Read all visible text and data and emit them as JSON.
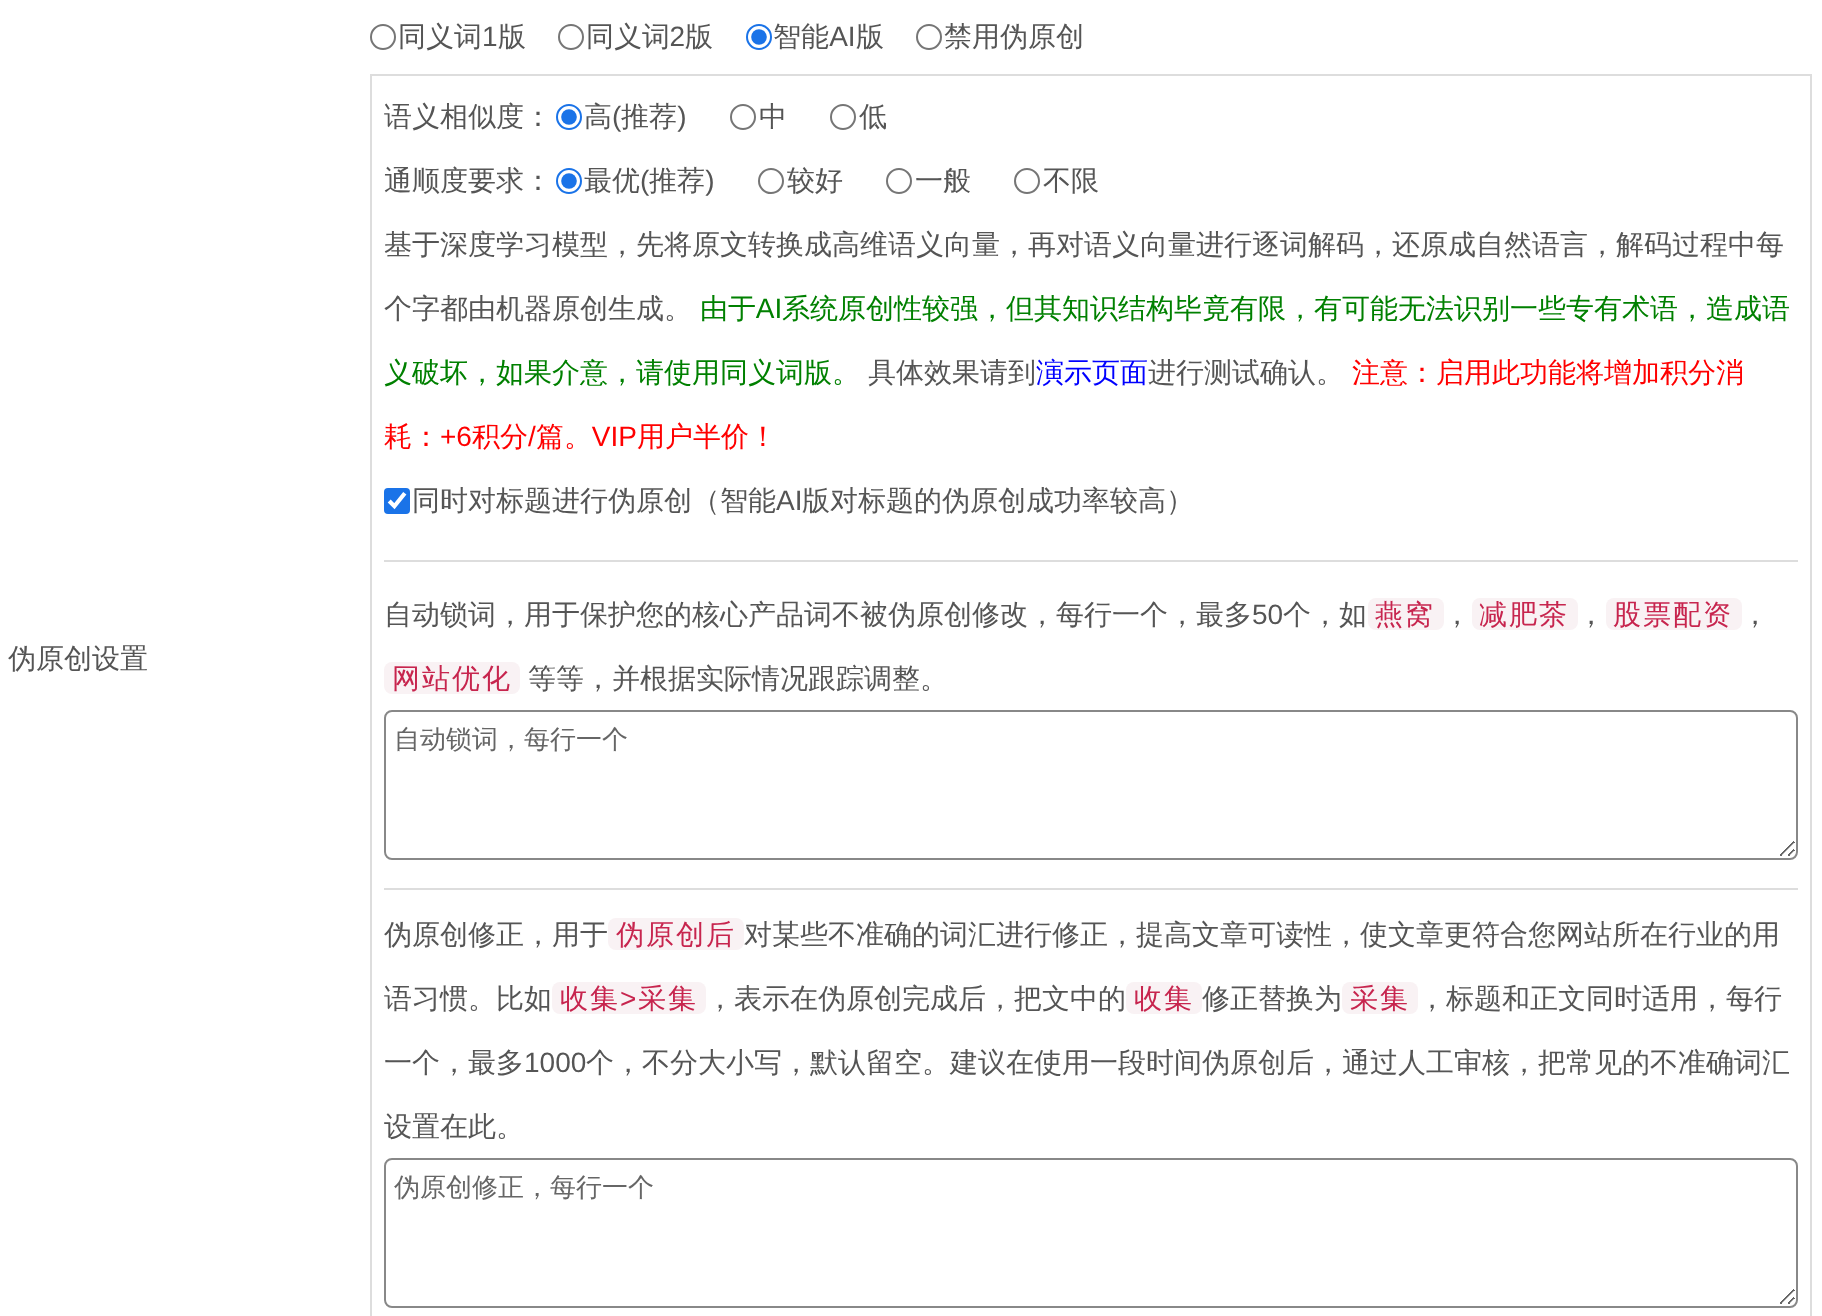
{
  "section_label": "伪原创设置",
  "modes": [
    {
      "label": "同义词1版",
      "selected": false
    },
    {
      "label": "同义词2版",
      "selected": false
    },
    {
      "label": "智能AI版",
      "selected": true
    },
    {
      "label": "禁用伪原创",
      "selected": false
    }
  ],
  "ai_options": [
    {
      "label": "语义相似度：",
      "options": [
        {
          "label": "高(推荐)",
          "selected": true
        },
        {
          "label": "中",
          "selected": false
        },
        {
          "label": "低",
          "selected": false
        }
      ]
    },
    {
      "label": "通顺度要求：",
      "options": [
        {
          "label": "最优(推荐)",
          "selected": true
        },
        {
          "label": "较好",
          "selected": false
        },
        {
          "label": "一般",
          "selected": false
        },
        {
          "label": "不限",
          "selected": false
        }
      ]
    }
  ],
  "ai_description": [
    {
      "kind": "plain",
      "text": "基于深度学习模型，先将原文转换成高维语义向量，再对语义向量进行逐词解码，还原成自然语言，解码过程中每个字都由机器原创生成。 "
    },
    {
      "kind": "green",
      "text": "由于AI系统原创性较强，但其知识结构毕竟有限，有可能无法识别一些专有术语，造成语义破坏，如果介意，请使用同义词版。"
    },
    {
      "kind": "plain",
      "text": " 具体效果请到"
    },
    {
      "kind": "link",
      "text": "演示页面"
    },
    {
      "kind": "plain",
      "text": "进行测试确认。 "
    },
    {
      "kind": "red",
      "text": "注意：启用此功能将增加积分消耗：+6积分/篇。VIP用户半价！"
    }
  ],
  "title_checkbox": {
    "label": "同时对标题进行伪原创（智能AI版对标题的伪原创成功率较高）",
    "checked": true
  },
  "lock_words": {
    "description": [
      {
        "kind": "plain",
        "text": "自动锁词，用于保护您的核心产品词不被伪原创修改，每行一个，最多50个，如"
      },
      {
        "kind": "tag",
        "text": "燕窝"
      },
      {
        "kind": "plain",
        "text": "，"
      },
      {
        "kind": "tag",
        "text": "减肥茶"
      },
      {
        "kind": "plain",
        "text": "，"
      },
      {
        "kind": "tag",
        "text": "股票配资"
      },
      {
        "kind": "plain",
        "text": "，"
      },
      {
        "kind": "tag",
        "text": "网站优化"
      },
      {
        "kind": "plain",
        "text": " 等等，并根据实际情况跟踪调整。"
      }
    ],
    "placeholder": "自动锁词，每行一个"
  },
  "corrections": {
    "description": [
      {
        "kind": "plain",
        "text": "伪原创修正，用于"
      },
      {
        "kind": "tag",
        "text": "伪原创后"
      },
      {
        "kind": "plain",
        "text": "对某些不准确的词汇进行修正，提高文章可读性，使文章更符合您网站所在行业的用语习惯。比如"
      },
      {
        "kind": "tag",
        "text": "收集>采集"
      },
      {
        "kind": "plain",
        "text": "，表示在伪原创完成后，把文中的"
      },
      {
        "kind": "tag",
        "text": "收集"
      },
      {
        "kind": "plain",
        "text": "修正替换为"
      },
      {
        "kind": "tag",
        "text": "采集"
      },
      {
        "kind": "plain",
        "text": "，标题和正文同时适用，每行一个，最多1000个，不分大小写，默认留空。建议在使用一段时间伪原创后，通过人工审核，把常见的不准确词汇设置在此。"
      }
    ],
    "placeholder": "伪原创修正，每行一个"
  }
}
